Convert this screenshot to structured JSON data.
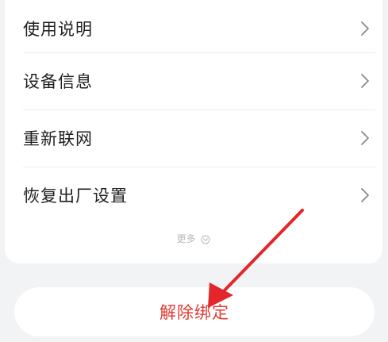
{
  "menu": {
    "items": [
      {
        "label": "使用说明"
      },
      {
        "label": "设备信息"
      },
      {
        "label": "重新联网"
      },
      {
        "label": "恢复出厂设置"
      }
    ],
    "more_label": "更多"
  },
  "actions": {
    "unbind_label": "解除绑定"
  },
  "icons": {
    "row_chevron": "chevron-right-icon",
    "more": "chevron-down-circle-icon",
    "annotation": "red-arrow-annotation"
  },
  "colors": {
    "background": "#f2f3f5",
    "card": "#ffffff",
    "text": "#1f1f1f",
    "unbind_text": "#e03a2f",
    "annotation_arrow": "#e3262a"
  }
}
